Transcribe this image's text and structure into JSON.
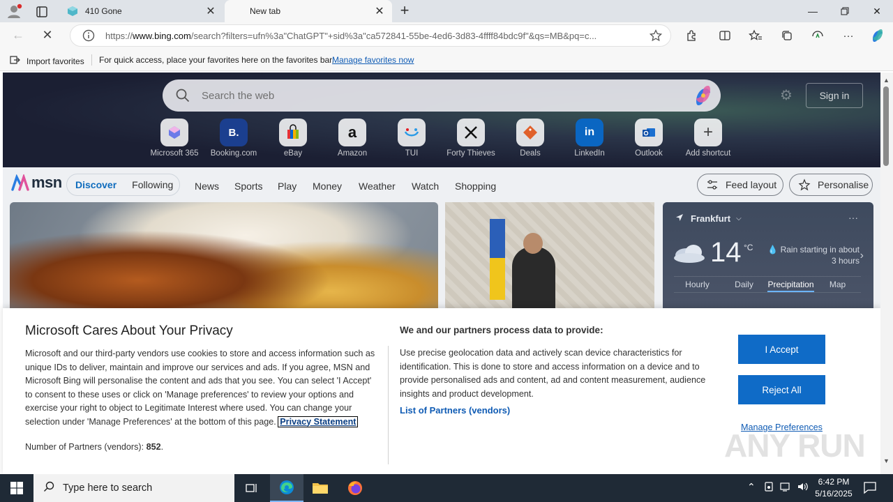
{
  "browser": {
    "tabs": [
      {
        "title": "410 Gone"
      },
      {
        "title": "New tab"
      }
    ],
    "url_prefix": "https://",
    "url_host": "www.bing.com",
    "url_path": "/search?filters=ufn%3a\"ChatGPT\"+sid%3a\"ca572841-55be-4ed6-3d83-4ffff84bdc9f\"&qs=MB&pq=c..."
  },
  "favbar": {
    "import_label": "Import favorites",
    "message": "For quick access, place your favorites here on the favorites bar.",
    "manage_link": "Manage favorites now"
  },
  "hero": {
    "search_placeholder": "Search the web",
    "signin_label": "Sign in",
    "shortcuts": [
      {
        "name": "Microsoft 365",
        "glyph": "",
        "color": "#5b6bd6"
      },
      {
        "name": "Booking.com",
        "glyph": "B.",
        "color": "#1b3f8f"
      },
      {
        "name": "eBay",
        "glyph": "",
        "color": "#e53238"
      },
      {
        "name": "Amazon",
        "glyph": "a",
        "color": "#111111"
      },
      {
        "name": "TUI",
        "glyph": "",
        "color": "#2b9be6"
      },
      {
        "name": "Forty Thieves",
        "glyph": "",
        "color": "#111111"
      },
      {
        "name": "Deals",
        "glyph": "",
        "color": "#e0602a"
      },
      {
        "name": "LinkedIn",
        "glyph": "in",
        "color": "#0a66c2"
      },
      {
        "name": "Outlook",
        "glyph": "",
        "color": "#1a6fd0"
      },
      {
        "name": "Add shortcut",
        "glyph": "+",
        "color": "#444444"
      }
    ]
  },
  "msn": {
    "logo_text": "msn",
    "discover": "Discover",
    "following": "Following",
    "nav": [
      "News",
      "Sports",
      "Play",
      "Money",
      "Weather",
      "Watch",
      "Shopping"
    ],
    "feed_layout": "Feed layout",
    "personalise": "Personalise"
  },
  "weather": {
    "location": "Frankfurt",
    "temp": "14",
    "unit": "°C",
    "forecast_line1": "Rain starting in about",
    "forecast_line2": "3 hours",
    "tabs": [
      "Hourly",
      "Daily",
      "Precipitation",
      "Map"
    ],
    "active_tab": "Precipitation"
  },
  "privacy": {
    "title": "Microsoft Cares About Your Privacy",
    "body": "Microsoft and our third-party vendors use cookies to store and access information such as unique IDs to deliver, maintain and improve our services and ads. If you agree, MSN and Microsoft Bing will personalise the content and ads that you see. You can select 'I Accept' to consent to these uses or click on 'Manage preferences' to review your options and exercise your right to object to Legitimate Interest where used.  You can change your selection under 'Manage Preferences' at the bottom of this page.",
    "privacy_link": "Privacy Statement",
    "partners_label": "Number of Partners (vendors):",
    "partners_count": "852",
    "right_title": "We and our partners process data to provide:",
    "right_body": "Use precise geolocation data and actively scan device characteristics for identification. This is done to store and access information on a device and to provide personalised ads and content, ad and content measurement, audience insights and product development.",
    "list_partners": "List of Partners (vendors)",
    "accept": "I Accept",
    "reject": "Reject All",
    "manage": "Manage Preferences"
  },
  "watermark": "ANY RUN",
  "taskbar": {
    "search_placeholder": "Type here to search",
    "time": "6:42 PM",
    "date": "5/16/2025"
  },
  "colors": {
    "accent": "#0f6bc7",
    "link": "#0f5bb4",
    "taskbar": "#1f2a36"
  }
}
